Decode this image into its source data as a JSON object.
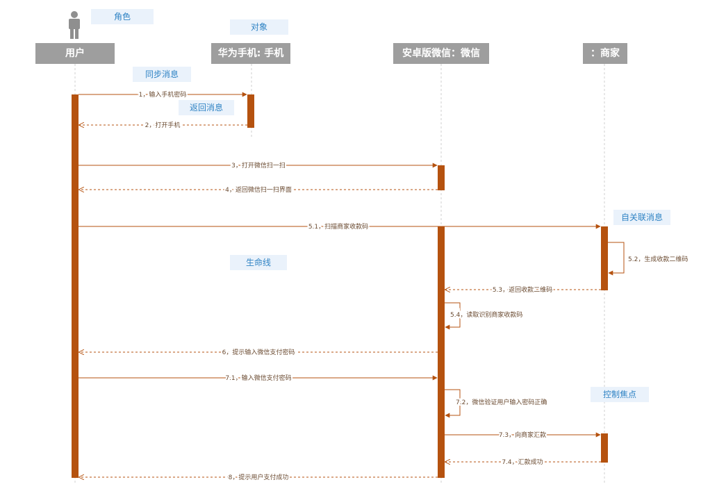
{
  "lifelines": {
    "user": "用户",
    "phone": "华为手机: 手机",
    "wechat": "安卓版微信：微信",
    "merchant": "：商家"
  },
  "notes": {
    "actor": "角色",
    "object": "对象",
    "sync_message": "同步消息",
    "return_message": "返回消息",
    "lifeline": "生命线",
    "self_message": "自关联消息",
    "focus_of_control": "控制焦点"
  },
  "messages": [
    "1，输入手机密码",
    "2，打开手机",
    "3，打开微信扫一扫",
    "4，返回微信扫一扫界面",
    "5.1，扫描商家收款码",
    "5.2，生成收款二维码",
    "5.3，返回收款二维码",
    "5.4，读取识别商家收款码",
    "6，提示输入微信支付密码",
    "7.1，输入微信支付密码",
    "7.2，微信验证用户输入密码正确",
    "7.3，向商家汇款",
    "7.4，汇款成功",
    "8，提示用户支付成功"
  ],
  "colors": {
    "activation": "#b5520f",
    "header": "#9e9e9e",
    "note_bg": "#eaf2fb",
    "note_text": "#2f83c4"
  },
  "icons": [
    "actor-icon"
  ]
}
